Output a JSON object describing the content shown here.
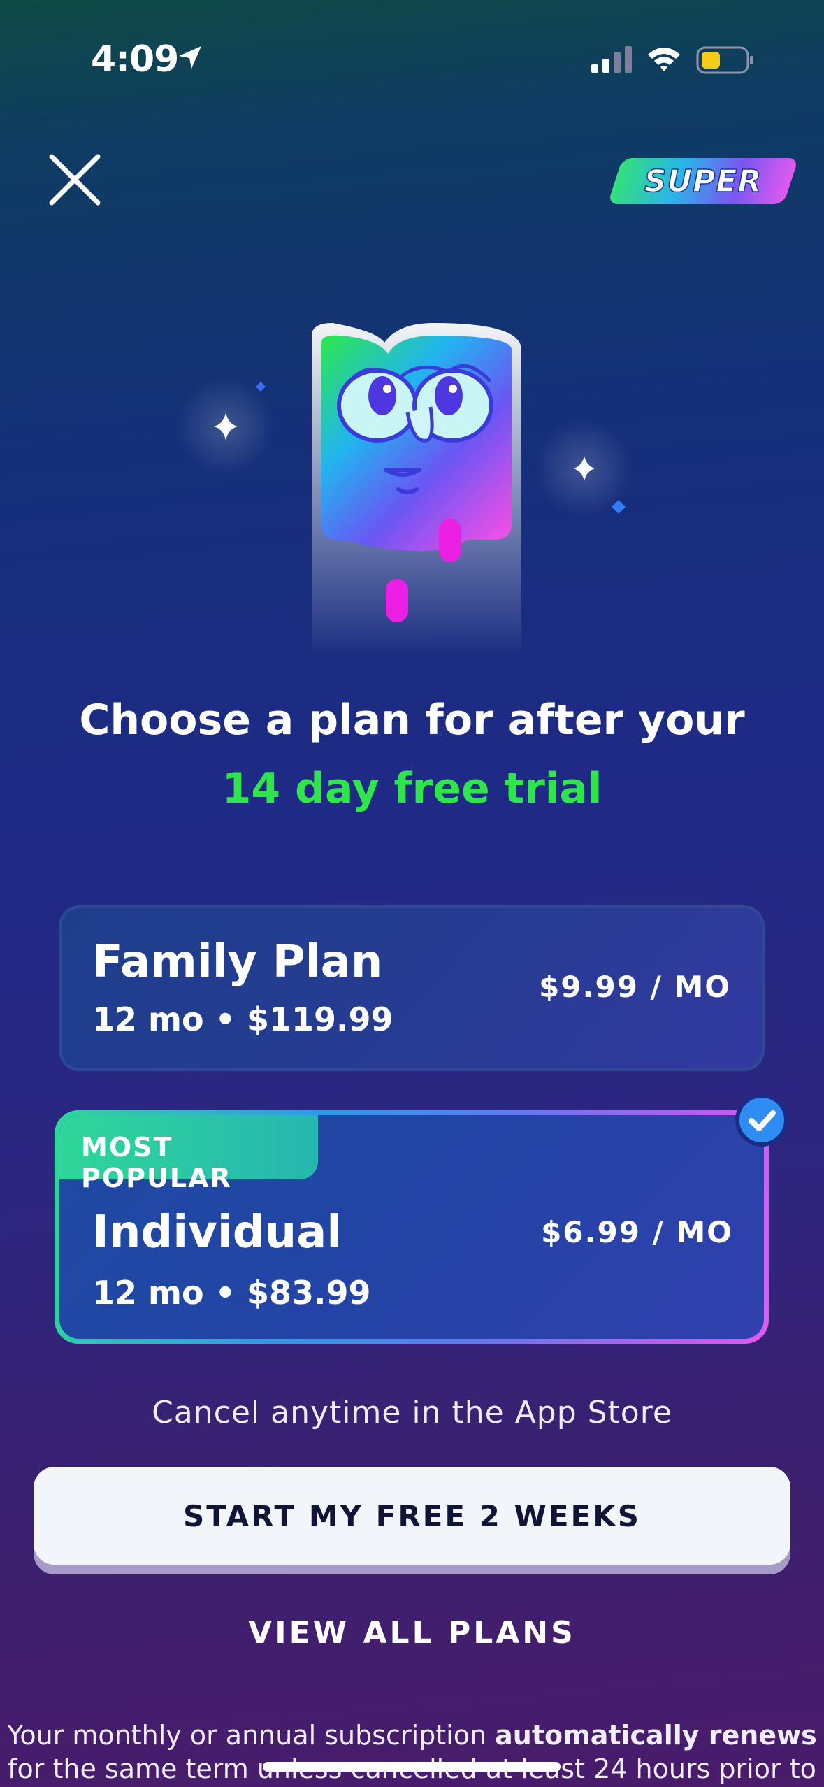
{
  "status_bar": {
    "time": "4:09"
  },
  "header": {
    "badge_text": "SUPER"
  },
  "headline": {
    "line1": "Choose a plan for after your",
    "line2": "14 day free trial"
  },
  "plans": [
    {
      "name": "Family Plan",
      "detail": "12 mo • $119.99",
      "price": "$9.99 / MO",
      "selected": false
    },
    {
      "name": "Individual",
      "detail": "12 mo • $83.99",
      "price": "$6.99 / MO",
      "tag": "MOST POPULAR",
      "selected": true
    }
  ],
  "cancel_note": "Cancel anytime in the App Store",
  "primary_button": "START MY FREE 2 WEEKS",
  "secondary_link": "VIEW ALL PLANS",
  "legal": {
    "line1_prefix": "Your monthly or annual subscription ",
    "line1_bold": "automatically renews",
    "line2": "for the same term unless cancelled at least 24 hours prior to"
  },
  "colors": {
    "accent_green": "#2ee64a",
    "check_blue": "#2f8cf2",
    "button_bg": "#f2f6fb",
    "button_text": "#101537"
  },
  "icons": [
    "close-icon",
    "location-arrow-icon",
    "signal-icon",
    "wifi-icon",
    "battery-icon",
    "checkmark-icon",
    "sparkle-icon"
  ]
}
